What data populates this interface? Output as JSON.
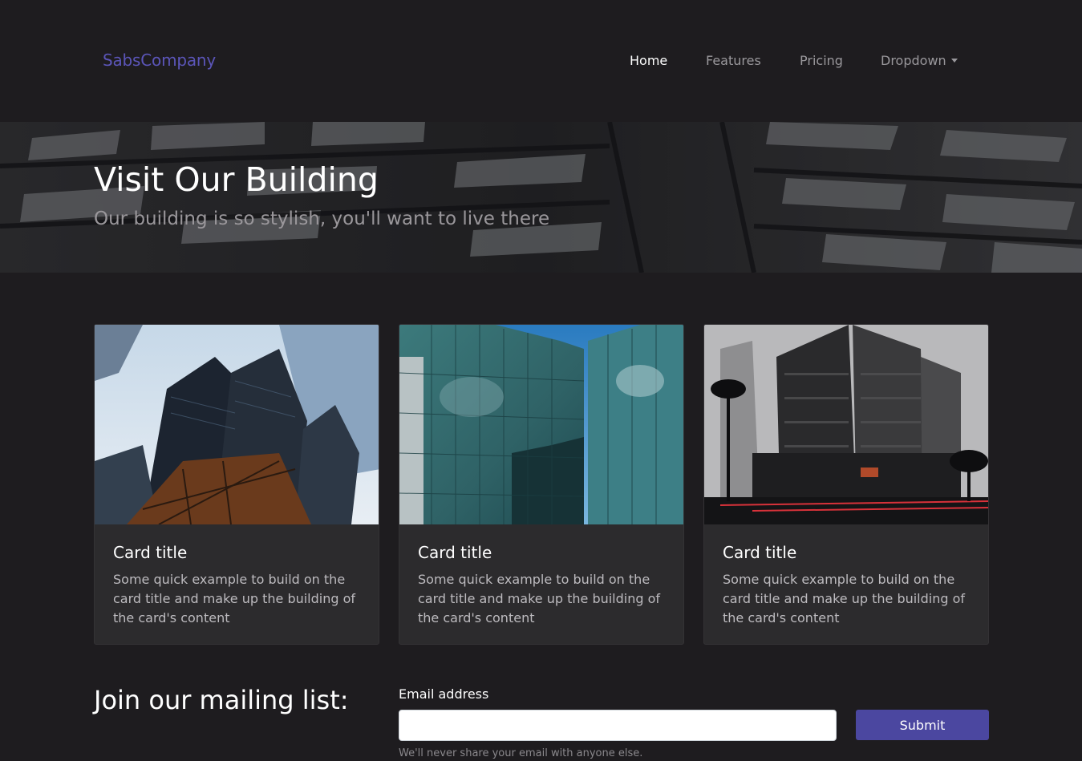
{
  "brand": "SabsCompany",
  "nav": {
    "items": [
      {
        "label": "Home",
        "active": true
      },
      {
        "label": "Features",
        "active": false
      },
      {
        "label": "Pricing",
        "active": false
      },
      {
        "label": "Dropdown",
        "active": false
      }
    ]
  },
  "hero": {
    "title": "Visit Our Building",
    "subtitle": "Our building is so stylish, you'll want to live there"
  },
  "cards": [
    {
      "title": "Card title",
      "text": "Some quick example to build on the card title and make up the building of the card's content",
      "image": "skyscrapers-looking-up-photo"
    },
    {
      "title": "Card title",
      "text": "Some quick example to build on the card title and make up the building of the card's content",
      "image": "curved-glass-facade-photo"
    },
    {
      "title": "Card title",
      "text": "Some quick example to build on the card title and make up the building of the card's content",
      "image": "dark-towers-street-photo"
    }
  ],
  "mailing": {
    "heading": "Join our mailing list:",
    "email_label": "Email address",
    "email_value": "",
    "submit_label": "Submit",
    "help_text": "We'll never share your email with anyone else."
  },
  "colors": {
    "background": "#1e1c1f",
    "brand": "#5b55b8",
    "card_background": "#2c2b2d",
    "button": "#4b47a0"
  }
}
